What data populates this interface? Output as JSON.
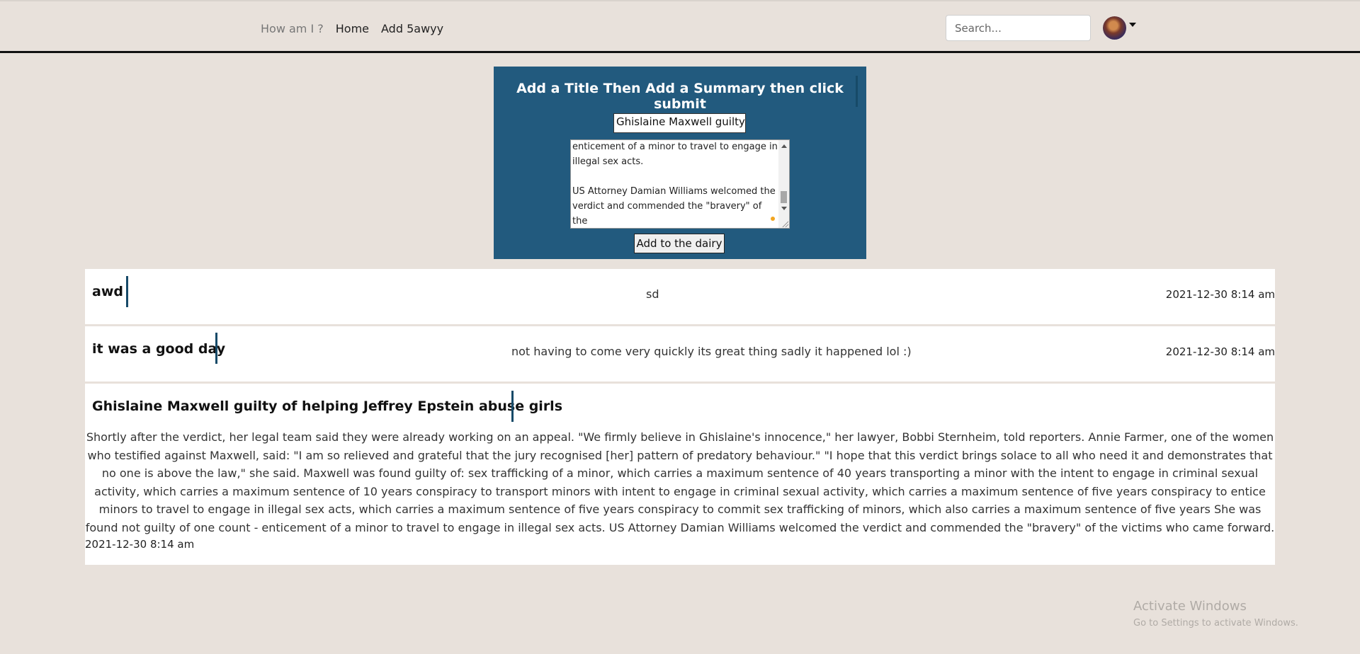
{
  "nav": {
    "brand": "How am I ?",
    "links": [
      "Home",
      "Add 5awyy"
    ],
    "search_placeholder": "Search..."
  },
  "form": {
    "heading": "Add a Title Then Add a Summary then click submit",
    "title_value": "Ghislaine Maxwell guilty c",
    "summary_visible": "enticement of a minor to travel to engage in\nillegal sex acts.\n\nUS Attorney Damian Williams welcomed the\nverdict and commended the \"bravery\" of the\nvictims who came forward.",
    "submit_label": "Add to the dairy"
  },
  "entries": [
    {
      "title": "awd",
      "summary": "sd",
      "date": "2021-12-30 8:14 am"
    },
    {
      "title": "it was a good day",
      "summary": "not having to come very quickly its great thing sadly it happened lol :)",
      "date": "2021-12-30 8:14 am"
    },
    {
      "title": "Ghislaine Maxwell guilty of helping Jeffrey Epstein abuse girls",
      "summary": "Shortly after the verdict, her legal team said they were already working on an appeal. \"We firmly believe in Ghislaine's innocence,\" her lawyer, Bobbi Sternheim, told reporters. Annie Farmer, one of the women who testified against Maxwell, said: \"I am so relieved and grateful that the jury recognised [her] pattern of predatory behaviour.\" \"I hope that this verdict brings solace to all who need it and demonstrates that no one is above the law,\" she said. Maxwell was found guilty of: sex trafficking of a minor, which carries a maximum sentence of 40 years transporting a minor with the intent to engage in criminal sexual activity, which carries a maximum sentence of 10 years conspiracy to transport minors with intent to engage in criminal sexual activity, which carries a maximum sentence of five years conspiracy to entice minors to travel to engage in illegal sex acts, which carries a maximum sentence of five years conspiracy to commit sex trafficking of minors, which also carries a maximum sentence of five years She was found not guilty of one count - enticement of a minor to travel to engage in illegal sex acts. US Attorney Damian Williams welcomed the verdict and commended the \"bravery\" of the victims who came forward.",
      "date": "2021-12-30 8:14 am"
    }
  ],
  "watermark": {
    "line1": "Activate Windows",
    "line2": "Go to Settings to activate Windows."
  },
  "colors": {
    "page_bg": "#e8e1db",
    "form_bg": "#225a7e",
    "accent_bar": "#174a68"
  }
}
